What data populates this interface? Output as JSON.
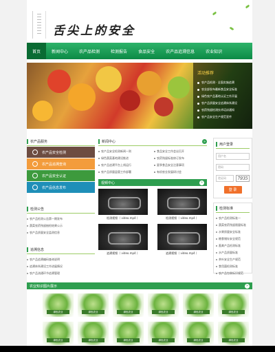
{
  "header": {
    "logo_text": "舌尖上的安全"
  },
  "nav": {
    "items": [
      "首页",
      "新闻中心",
      "农产品检测",
      "检测报告",
      "食品安全",
      "农产品追溯信息",
      "农业知识"
    ]
  },
  "banner": {
    "panel_title": "活动推荐",
    "items": [
      "农产品检测 · 全面实施追溯",
      "农业部发布最新食品安全标准",
      "绿色农产品基地认证工作开展",
      "农产品质量安全追溯体系建设",
      "农药残留检测技术培训通知",
      "农产品安全生产规范宣传"
    ]
  },
  "left": {
    "quick_title": "农产品服务",
    "quick_buttons": [
      "农产品安全检测",
      "农产品追溯查询",
      "农产品安全认证",
      "农产品信息发布"
    ],
    "section1_title": "检测公告",
    "section1_items": [
      "农产品检测公告第一期发布",
      "蔬菜农药残留抽检结果公示",
      "农产品质量安全监测信息"
    ],
    "section2_title": "追溯信息",
    "section2_items": [
      "农产品追溯编码查询说明",
      "追溯体系建设工作进展情况",
      "农产品流通环节追溯管理"
    ]
  },
  "middle": {
    "news_title": "新闻中心",
    "news_items": [
      "农产品安全检测新闻一则",
      "食品安全工作会议召开",
      "绿色蔬菜基地建设推进",
      "农药残留标准修订发布",
      "农产品追溯平台上线运行",
      "夏季食品安全注意事项",
      "农产品质量监管工作部署",
      "有机农业发展研讨会"
    ],
    "video_title": "视频中心",
    "videos": [
      "检测视频（ video.mp4 ）",
      "检测视频（ video.mp4 ）",
      "追溯视频（ video.mp4 ）",
      "追溯视频（ video.mp4 ）"
    ]
  },
  "right": {
    "login_title": "用户登录",
    "username_placeholder": "用户名",
    "password_placeholder": "密码",
    "captcha_placeholder": "验证码",
    "captcha_text": "7935",
    "login_button": "登 录",
    "list_title": "检测标准",
    "list_items": [
      "农产品检测标准一",
      "蔬菜农药残留限量标准",
      "水果质量安全标准",
      "粮食储存安全规范",
      "畜禽产品检测标准",
      "水产品质量标准",
      "茶叶安全生产规范",
      "食用菌检测标准",
      "农产品包装标识规范"
    ]
  },
  "bottom": {
    "title": "农业知识图片展示",
    "gallery_tags": [
      "绿色农业",
      "绿色农业",
      "绿色农业",
      "绿色农业",
      "绿色农业",
      "绿色农业",
      "绿色农业",
      "绿色农业",
      "绿色农业",
      "绿色农业",
      "绿色农业",
      "绿色农业"
    ]
  },
  "more_label": "»",
  "colors": {
    "primary_green": "#2e9e4f",
    "nav_dark": "#0a6b33",
    "accent_orange": "#f0702a"
  }
}
